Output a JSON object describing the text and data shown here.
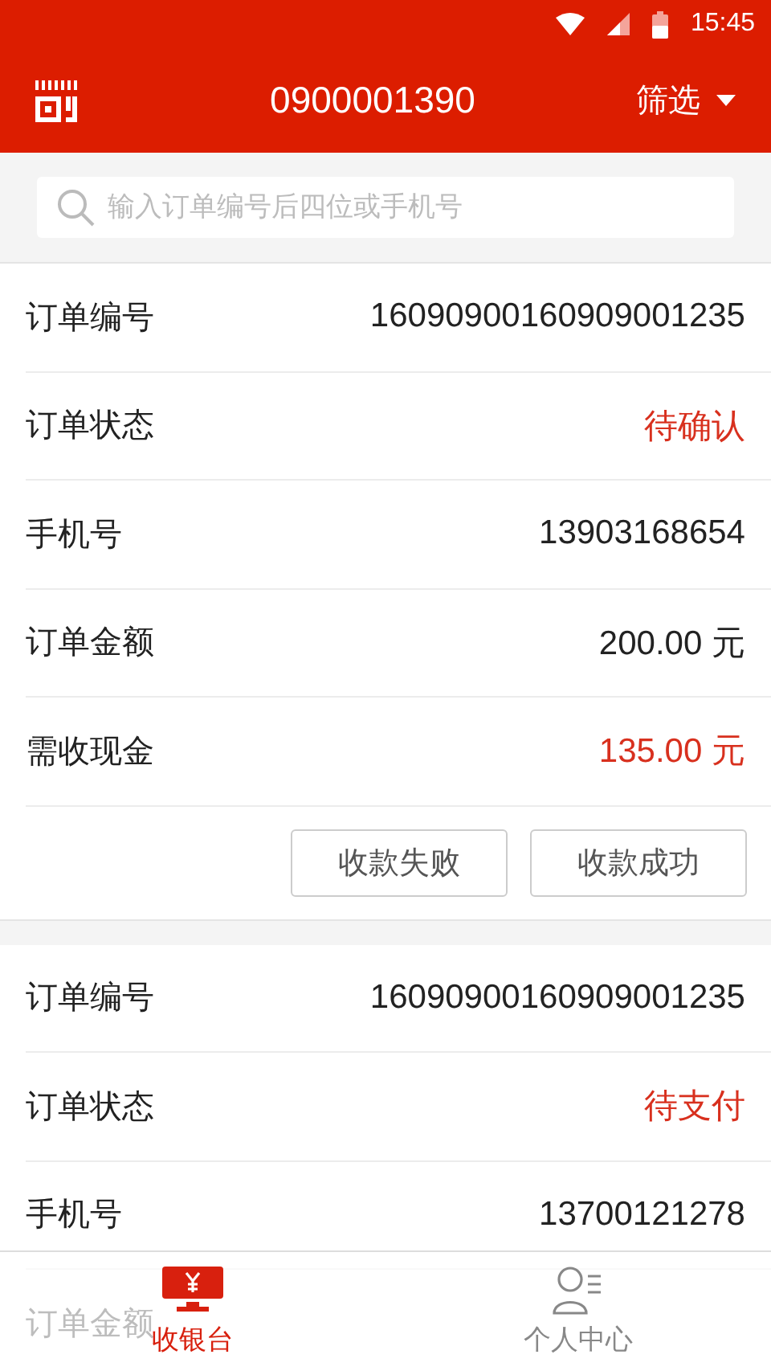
{
  "status_bar": {
    "time": "15:45"
  },
  "header": {
    "title": "0900001390",
    "filter": "筛选"
  },
  "search": {
    "placeholder": "输入订单编号后四位或手机号"
  },
  "orders": [
    {
      "rows": [
        {
          "label": "订单编号",
          "value": "16090900160909001235",
          "highlight": false
        },
        {
          "label": "订单状态",
          "value": "待确认",
          "highlight": true
        },
        {
          "label": "手机号",
          "value": "13903168654",
          "highlight": false
        },
        {
          "label": "订单金额",
          "value": "200.00 元",
          "highlight": false
        },
        {
          "label": "需收现金",
          "value": "135.00 元",
          "highlight": true
        }
      ],
      "buttons": [
        "收款失败",
        "收款成功"
      ]
    },
    {
      "rows": [
        {
          "label": "订单编号",
          "value": "16090900160909001235",
          "highlight": false
        },
        {
          "label": "订单状态",
          "value": "待支付",
          "highlight": true
        },
        {
          "label": "手机号",
          "value": "13700121278",
          "highlight": false
        },
        {
          "label": "订单金额"
        }
      ]
    }
  ],
  "nav": [
    {
      "label": "收银台",
      "kind": "cashier",
      "selected": true
    },
    {
      "label": "个人中心",
      "kind": "profile",
      "selected": false
    }
  ]
}
